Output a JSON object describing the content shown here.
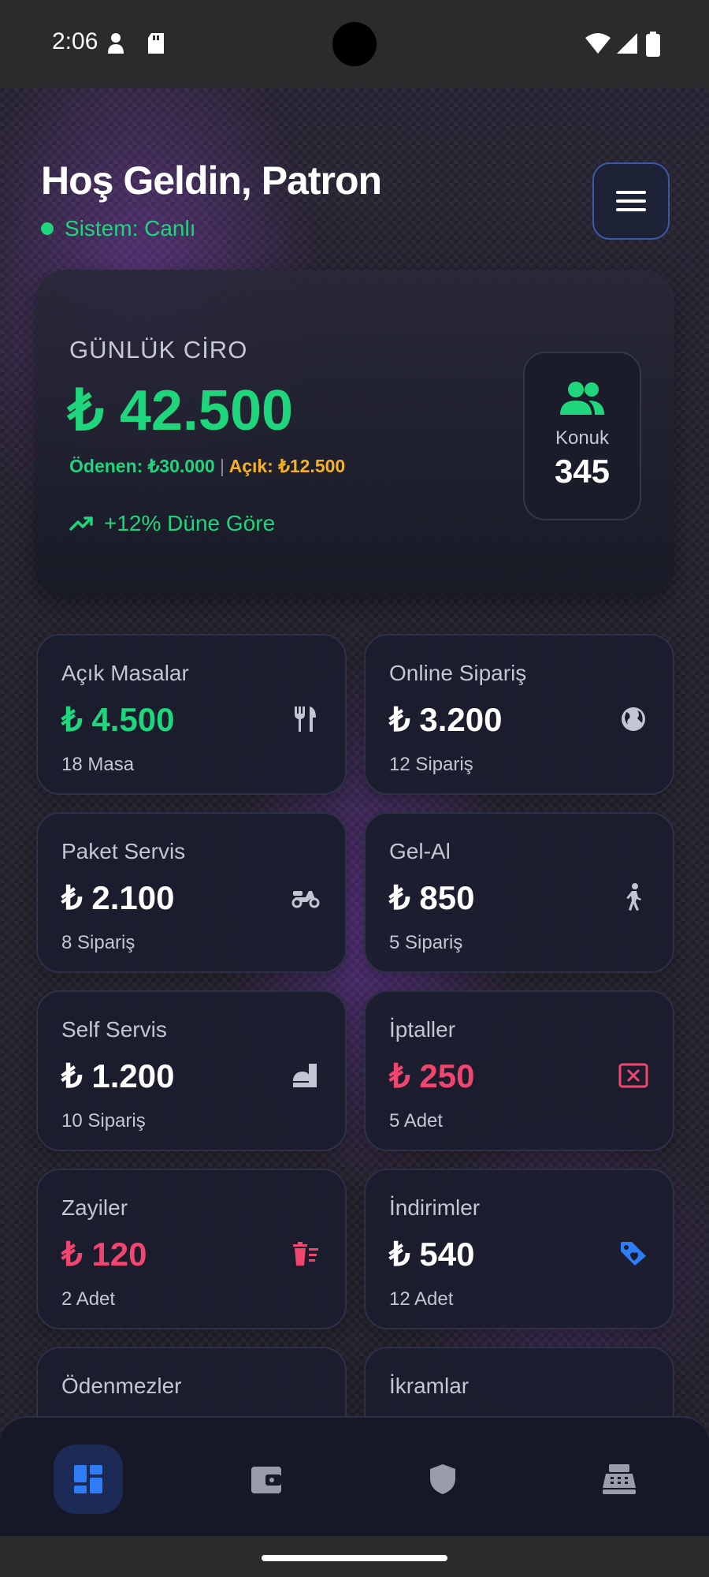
{
  "status_bar": {
    "time": "2:06",
    "icons": [
      "person-icon",
      "sd-card-icon",
      "wifi-icon",
      "signal-icon",
      "battery-icon"
    ]
  },
  "header": {
    "greeting": "Hoş Geldin, Patron",
    "status": "Sistem: Canlı",
    "menu_icon": "hamburger-menu-icon"
  },
  "hero": {
    "label": "GÜNLÜK CİRO",
    "value": "₺ 42.500",
    "paid": "Ödenen: ₺30.000",
    "separator": "|",
    "open": "Açık: ₺12.500",
    "trend": "+12% Düne Göre",
    "guest_label": "Konuk",
    "guest_value": "345"
  },
  "cards": [
    {
      "title": "Açık Masalar",
      "value": "₺ 4.500",
      "sub": "18 Masa",
      "icon": "cutlery-icon",
      "color": "#1fd67c"
    },
    {
      "title": "Online Sipariş",
      "value": "₺ 3.200",
      "sub": "12 Sipariş",
      "icon": "globe-icon",
      "color": "#ffffff"
    },
    {
      "title": "Paket Servis",
      "value": "₺ 2.100",
      "sub": "8 Sipariş",
      "icon": "scooter-icon",
      "color": "#ffffff"
    },
    {
      "title": "Gel-Al",
      "value": "₺ 850",
      "sub": "5 Sipariş",
      "icon": "walking-icon",
      "color": "#ffffff"
    },
    {
      "title": "Self Servis",
      "value": "₺ 1.200",
      "sub": "10 Sipariş",
      "icon": "room-service-icon",
      "color": "#ffffff"
    },
    {
      "title": "İptaller",
      "value": "₺ 250",
      "sub": "5 Adet",
      "icon": "cancel-box-icon",
      "color": "#f0456e"
    },
    {
      "title": "Zayiler",
      "value": "₺ 120",
      "sub": "2 Adet",
      "icon": "trash-icon",
      "color": "#f0456e"
    },
    {
      "title": "İndirimler",
      "value": "₺ 540",
      "sub": "12 Adet",
      "icon": "discount-tag-icon",
      "color": "#ffffff"
    },
    {
      "title": "Ödenmezler",
      "value": "",
      "sub": "",
      "icon": "",
      "color": "#ffffff"
    },
    {
      "title": "İkramlar",
      "value": "",
      "sub": "",
      "icon": "",
      "color": "#ffffff"
    }
  ],
  "bottom_nav": [
    {
      "icon": "dashboard-icon",
      "active": true
    },
    {
      "icon": "wallet-icon",
      "active": false
    },
    {
      "icon": "shield-icon",
      "active": false
    },
    {
      "icon": "cash-register-icon",
      "active": false
    }
  ],
  "colors": {
    "accent_green": "#1fd67c",
    "accent_orange": "#f5b223",
    "accent_red": "#f0456e",
    "accent_blue": "#2f7cf6"
  }
}
